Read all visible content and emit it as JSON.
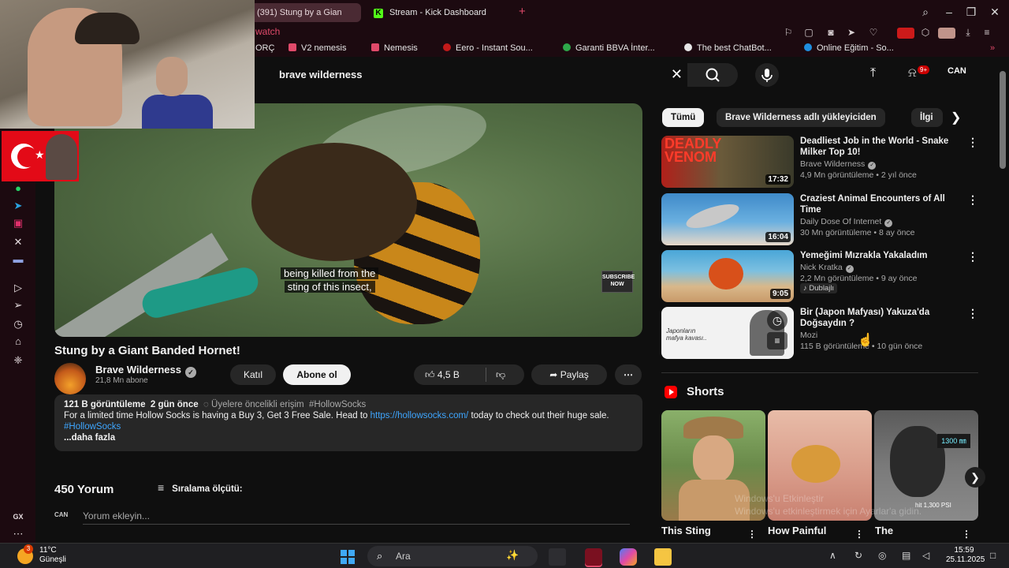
{
  "browser": {
    "tabs": [
      {
        "label": "(391) Stung by a Gian"
      },
      {
        "label": "Stream - Kick Dashboard"
      }
    ],
    "address_fragment": "watch",
    "bookmarks": [
      {
        "label": "ORÇ"
      },
      {
        "label": "V2 nemesis"
      },
      {
        "label": "Nemesis"
      },
      {
        "label": "Eero - Instant Sou..."
      },
      {
        "label": "Garanti BBVA İnter..."
      },
      {
        "label": "The best ChatBot..."
      },
      {
        "label": "Online Eğitim - So..."
      }
    ]
  },
  "youtube": {
    "search_query": "brave wilderness",
    "notification_count": "9+",
    "account_label": "CAN",
    "video": {
      "caption_line1": "being killed from the",
      "caption_line2": "sting of this insect,",
      "subscribe_overlay": "SUBSCRIBE NOW",
      "title": "Stung by a Giant Banded Hornet!",
      "channel": "Brave Wilderness",
      "subscribers": "21,8 Mn abone",
      "join_label": "Katıl",
      "subscribe_label": "Abone ol",
      "likes": "4,5 B",
      "share_label": "Paylaş",
      "description": {
        "views": "121 B görüntüleme",
        "age": "2 gün önce",
        "early_access": "Üyelere öncelikli erişim",
        "hashtag": "#HollowSocks",
        "text_before_link": "For a limited time Hollow Socks is having a Buy 3, Get 3 Free Sale. Head to ",
        "link": "https://hollowsocks.com/",
        "text_after_link": " today to check out their huge sale. ",
        "hashtag2": "#HollowSocks",
        "more": "...daha fazla"
      },
      "comments_count": "450 Yorum",
      "sort_label": "Sıralama ölçütü:",
      "comment_placeholder": "Yorum ekleyin..."
    },
    "chips": [
      {
        "label": "Tümü"
      },
      {
        "label": "Brave Wilderness adlı yükleyiciden"
      },
      {
        "label": "İlgi"
      }
    ],
    "recommendations": [
      {
        "title": "Deadliest Job in the World - Snake Milker Top 10!",
        "channel": "Brave Wilderness",
        "meta": "4,9 Mn görüntüleme • 2 yıl önce",
        "duration": "17:32",
        "thumb_text": "DEADLY VENOM"
      },
      {
        "title": "Craziest Animal Encounters of All Time",
        "channel": "Daily Dose Of Internet",
        "meta": "30 Mn görüntüleme • 8 ay önce",
        "duration": "16:04"
      },
      {
        "title": "Yemeğimi Mızrakla Yakaladım",
        "channel": "Nick Kratka",
        "meta": "2,2 Mn görüntüleme • 9 ay önce",
        "duration": "9:05",
        "badge": "Dublajlı"
      },
      {
        "title": "Bir (Japon Mafyası) Yakuza'da Doğsaydın ?",
        "channel": "Mozi",
        "meta": "115 B görüntüleme • 10 gün önce",
        "thumb_text": "Japonların mafya kavası.."
      }
    ],
    "shorts_label": "Shorts",
    "shorts": [
      {
        "title": "This Sting"
      },
      {
        "title": "How Painful"
      },
      {
        "title": "The"
      }
    ],
    "shorts_gauge_text": "1300 ㎜",
    "shorts_psi_label": "hit 1,300 PSI",
    "watermark_line1": "Windows'u Etkinleştir",
    "watermark_line2": "Windows'u etkinleştirmek için Ayarlar'a gidin."
  },
  "taskbar": {
    "temperature": "11°C",
    "weather": "Güneşli",
    "weather_badge": "3",
    "search_placeholder": "Ara",
    "time": "15:59",
    "date": "25.11.2025"
  },
  "colors": {
    "browser_bg": "#1c0a10",
    "opera_accent": "#e04a6a",
    "youtube_bg": "#0f0f0f",
    "link": "#3ea6ff",
    "youtube_red": "#ff0000"
  }
}
